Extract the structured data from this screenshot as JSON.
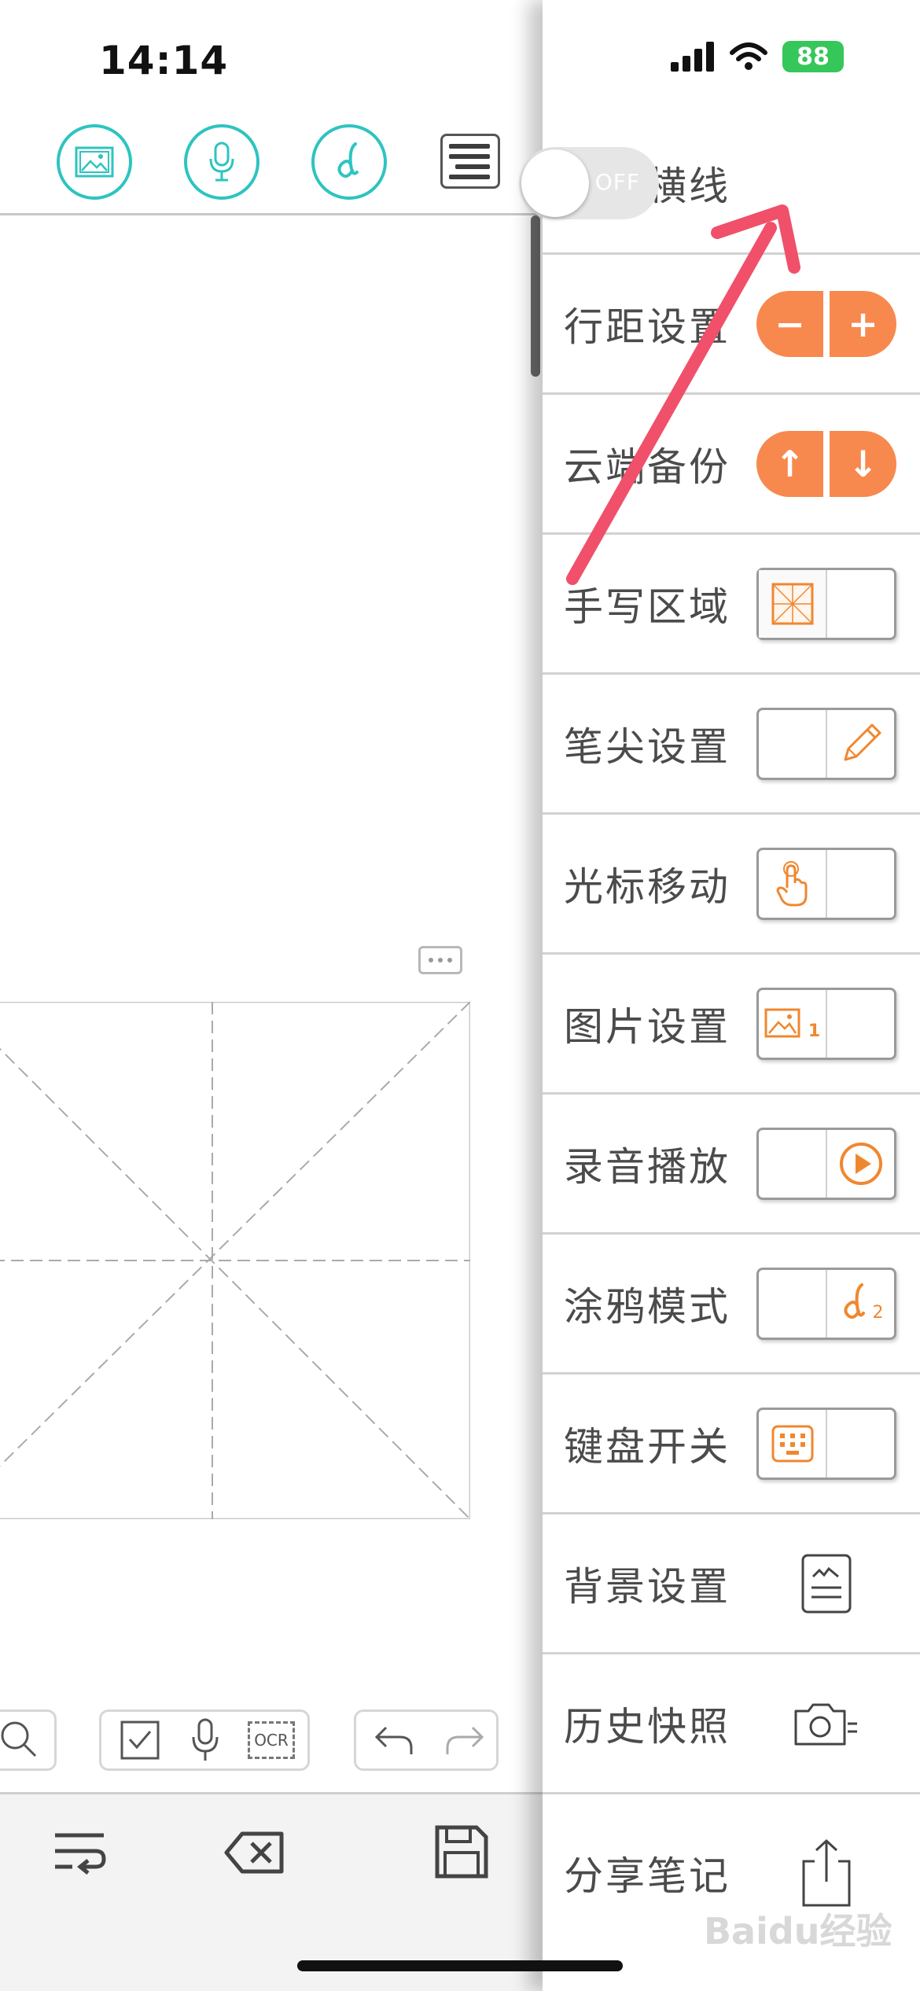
{
  "status_bar": {
    "time": "14:14",
    "battery": "88"
  },
  "toolbar": {
    "icons": [
      "image-icon",
      "microphone-icon",
      "handwriting-icon",
      "menu-icon"
    ]
  },
  "settings": [
    {
      "label": "分隔横线",
      "control": "toggle",
      "toggle_text": "OFF"
    },
    {
      "label": "行距设置",
      "control": "stepper",
      "buttons": [
        "−",
        "+"
      ]
    },
    {
      "label": "云端备份",
      "control": "stepper",
      "buttons": [
        "↑",
        "↓"
      ]
    },
    {
      "label": "手写区域",
      "control": "segment",
      "icon": "grid-icon"
    },
    {
      "label": "笔尖设置",
      "control": "segment",
      "icon": "pencil-icon"
    },
    {
      "label": "光标移动",
      "control": "segment",
      "icon": "hand-pointer-icon"
    },
    {
      "label": "图片设置",
      "control": "segment",
      "icon": "image-icon",
      "icon_sub": "1"
    },
    {
      "label": "录音播放",
      "control": "segment",
      "icon": "play-icon"
    },
    {
      "label": "涂鸦模式",
      "control": "segment",
      "icon": "doodle-icon",
      "icon_sub": "2"
    },
    {
      "label": "键盘开关",
      "control": "segment",
      "icon": "keyboard-icon"
    },
    {
      "label": "背景设置",
      "control": "icon",
      "icon": "background-icon"
    },
    {
      "label": "历史快照",
      "control": "icon",
      "icon": "camera-icon"
    },
    {
      "label": "分享笔记",
      "control": "icon",
      "icon": "share-icon"
    }
  ],
  "bottom_tools": {
    "ocr_label": "OCR"
  },
  "watermark": "Baidu经验",
  "accent_colors": {
    "teal": "#2ec4c0",
    "orange": "#f7894f",
    "annotation": "#f0506a"
  }
}
